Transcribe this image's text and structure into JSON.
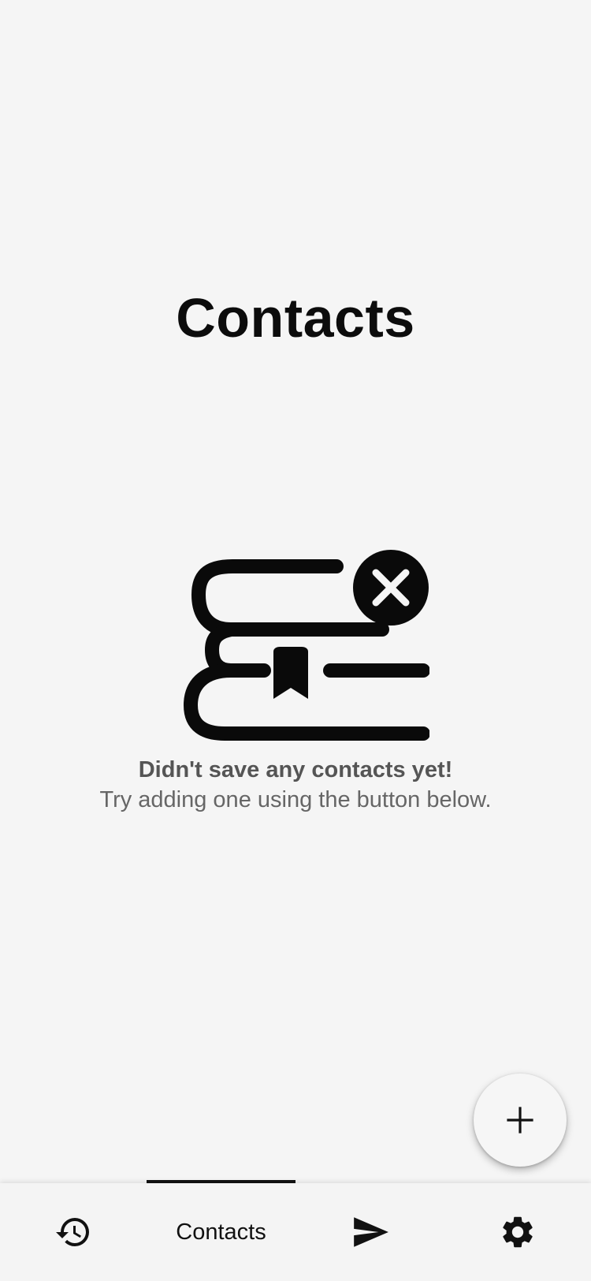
{
  "header": {
    "title": "Contacts"
  },
  "empty_state": {
    "icon": "books-x-icon",
    "heading": "Didn't save any contacts yet!",
    "subtext": "Try adding one using the button below."
  },
  "fab": {
    "icon": "plus-icon"
  },
  "bottom_nav": {
    "active_index": 1,
    "items": [
      {
        "icon": "history-icon",
        "label": ""
      },
      {
        "icon": "",
        "label": "Contacts"
      },
      {
        "icon": "send-icon",
        "label": ""
      },
      {
        "icon": "gear-icon",
        "label": ""
      }
    ]
  },
  "colors": {
    "background": "#f5f5f5",
    "text_primary": "#0c0c0c",
    "text_secondary": "#666666",
    "indicator": "#111111"
  }
}
